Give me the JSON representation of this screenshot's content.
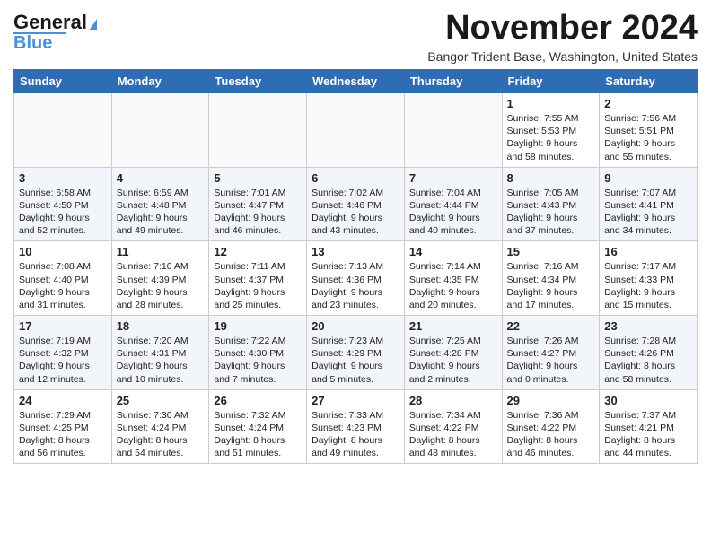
{
  "header": {
    "logo_line1": "General",
    "logo_line2": "Blue",
    "month": "November 2024",
    "subtitle": "Bangor Trident Base, Washington, United States"
  },
  "weekdays": [
    "Sunday",
    "Monday",
    "Tuesday",
    "Wednesday",
    "Thursday",
    "Friday",
    "Saturday"
  ],
  "weeks": [
    [
      {
        "day": "",
        "info": ""
      },
      {
        "day": "",
        "info": ""
      },
      {
        "day": "",
        "info": ""
      },
      {
        "day": "",
        "info": ""
      },
      {
        "day": "",
        "info": ""
      },
      {
        "day": "1",
        "info": "Sunrise: 7:55 AM\nSunset: 5:53 PM\nDaylight: 9 hours and 58 minutes."
      },
      {
        "day": "2",
        "info": "Sunrise: 7:56 AM\nSunset: 5:51 PM\nDaylight: 9 hours and 55 minutes."
      }
    ],
    [
      {
        "day": "3",
        "info": "Sunrise: 6:58 AM\nSunset: 4:50 PM\nDaylight: 9 hours and 52 minutes."
      },
      {
        "day": "4",
        "info": "Sunrise: 6:59 AM\nSunset: 4:48 PM\nDaylight: 9 hours and 49 minutes."
      },
      {
        "day": "5",
        "info": "Sunrise: 7:01 AM\nSunset: 4:47 PM\nDaylight: 9 hours and 46 minutes."
      },
      {
        "day": "6",
        "info": "Sunrise: 7:02 AM\nSunset: 4:46 PM\nDaylight: 9 hours and 43 minutes."
      },
      {
        "day": "7",
        "info": "Sunrise: 7:04 AM\nSunset: 4:44 PM\nDaylight: 9 hours and 40 minutes."
      },
      {
        "day": "8",
        "info": "Sunrise: 7:05 AM\nSunset: 4:43 PM\nDaylight: 9 hours and 37 minutes."
      },
      {
        "day": "9",
        "info": "Sunrise: 7:07 AM\nSunset: 4:41 PM\nDaylight: 9 hours and 34 minutes."
      }
    ],
    [
      {
        "day": "10",
        "info": "Sunrise: 7:08 AM\nSunset: 4:40 PM\nDaylight: 9 hours and 31 minutes."
      },
      {
        "day": "11",
        "info": "Sunrise: 7:10 AM\nSunset: 4:39 PM\nDaylight: 9 hours and 28 minutes."
      },
      {
        "day": "12",
        "info": "Sunrise: 7:11 AM\nSunset: 4:37 PM\nDaylight: 9 hours and 25 minutes."
      },
      {
        "day": "13",
        "info": "Sunrise: 7:13 AM\nSunset: 4:36 PM\nDaylight: 9 hours and 23 minutes."
      },
      {
        "day": "14",
        "info": "Sunrise: 7:14 AM\nSunset: 4:35 PM\nDaylight: 9 hours and 20 minutes."
      },
      {
        "day": "15",
        "info": "Sunrise: 7:16 AM\nSunset: 4:34 PM\nDaylight: 9 hours and 17 minutes."
      },
      {
        "day": "16",
        "info": "Sunrise: 7:17 AM\nSunset: 4:33 PM\nDaylight: 9 hours and 15 minutes."
      }
    ],
    [
      {
        "day": "17",
        "info": "Sunrise: 7:19 AM\nSunset: 4:32 PM\nDaylight: 9 hours and 12 minutes."
      },
      {
        "day": "18",
        "info": "Sunrise: 7:20 AM\nSunset: 4:31 PM\nDaylight: 9 hours and 10 minutes."
      },
      {
        "day": "19",
        "info": "Sunrise: 7:22 AM\nSunset: 4:30 PM\nDaylight: 9 hours and 7 minutes."
      },
      {
        "day": "20",
        "info": "Sunrise: 7:23 AM\nSunset: 4:29 PM\nDaylight: 9 hours and 5 minutes."
      },
      {
        "day": "21",
        "info": "Sunrise: 7:25 AM\nSunset: 4:28 PM\nDaylight: 9 hours and 2 minutes."
      },
      {
        "day": "22",
        "info": "Sunrise: 7:26 AM\nSunset: 4:27 PM\nDaylight: 9 hours and 0 minutes."
      },
      {
        "day": "23",
        "info": "Sunrise: 7:28 AM\nSunset: 4:26 PM\nDaylight: 8 hours and 58 minutes."
      }
    ],
    [
      {
        "day": "24",
        "info": "Sunrise: 7:29 AM\nSunset: 4:25 PM\nDaylight: 8 hours and 56 minutes."
      },
      {
        "day": "25",
        "info": "Sunrise: 7:30 AM\nSunset: 4:24 PM\nDaylight: 8 hours and 54 minutes."
      },
      {
        "day": "26",
        "info": "Sunrise: 7:32 AM\nSunset: 4:24 PM\nDaylight: 8 hours and 51 minutes."
      },
      {
        "day": "27",
        "info": "Sunrise: 7:33 AM\nSunset: 4:23 PM\nDaylight: 8 hours and 49 minutes."
      },
      {
        "day": "28",
        "info": "Sunrise: 7:34 AM\nSunset: 4:22 PM\nDaylight: 8 hours and 48 minutes."
      },
      {
        "day": "29",
        "info": "Sunrise: 7:36 AM\nSunset: 4:22 PM\nDaylight: 8 hours and 46 minutes."
      },
      {
        "day": "30",
        "info": "Sunrise: 7:37 AM\nSunset: 4:21 PM\nDaylight: 8 hours and 44 minutes."
      }
    ]
  ]
}
